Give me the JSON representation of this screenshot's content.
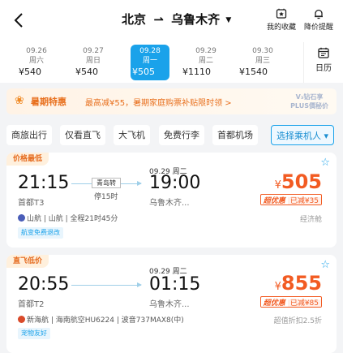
{
  "header": {
    "origin": "北京",
    "destination": "乌鲁木齐",
    "favorites_label": "我的收藏",
    "price_alert_label": "降价提醒"
  },
  "dates": [
    {
      "date": "09.26",
      "weekday": "周六",
      "price": "¥540"
    },
    {
      "date": "09.27",
      "weekday": "周日",
      "price": "¥540"
    },
    {
      "date": "09.28",
      "weekday": "周一",
      "price": "¥505"
    },
    {
      "date": "09.29",
      "weekday": "周二",
      "price": "¥1110"
    },
    {
      "date": "09.30",
      "weekday": "周三",
      "price": "¥1540"
    }
  ],
  "calendar_label": "日历",
  "promo": {
    "title": "暑期特惠",
    "text": "最高减¥55，暑期家庭购票补贴限时领 >",
    "badge_line1": "V₃钻石享",
    "badge_line2": "PLUS價秘价"
  },
  "filters": [
    "商旅出行",
    "仅看直飞",
    "大飞机",
    "免费行李",
    "首都机场",
    "选择乘机人 ▾"
  ],
  "flights": [
    {
      "tag": "价格最低",
      "arr_date": "09.29 周二",
      "dep_time": "21:15",
      "dep_airport": "首都T3",
      "arr_time": "19:00",
      "arr_airport": "乌鲁木齐...",
      "stop_city": "青岛转",
      "stop_duration": "停15时",
      "price_yen": "¥",
      "price": "505",
      "promo_a": "超优惠",
      "promo_b": "已减¥35",
      "airline": "山航 | 山航 | 全程21时45分",
      "cabin": "经济舱",
      "extra_tag": "航变免费退改"
    },
    {
      "tag": "直飞低价",
      "arr_date": "09.29 周二",
      "dep_time": "20:55",
      "dep_airport": "首都T2",
      "arr_time": "01:15",
      "arr_airport": "乌鲁木齐...",
      "price_yen": "¥",
      "price": "855",
      "promo_a": "超优惠",
      "promo_b": "已减¥85",
      "airline": "新海航 | 海南航空HU6224 | 波音737MAX8(中)",
      "cabin": "超值折扣2.5折",
      "extra_tag": "宠物友好"
    }
  ],
  "colors": {
    "accent": "#1aa2ea",
    "price": "#f25b22",
    "promo": "#e8701e"
  }
}
